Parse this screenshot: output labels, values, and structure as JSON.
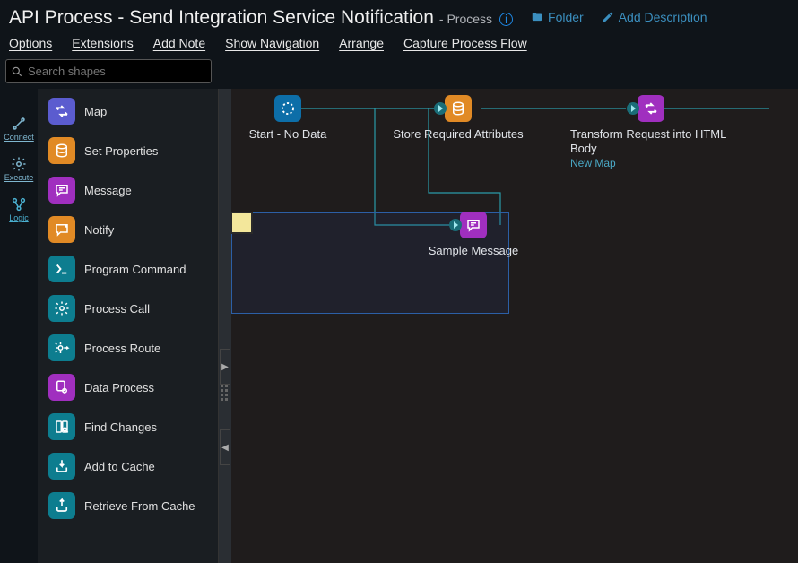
{
  "header": {
    "title": "API Process - Send Integration Service Notification",
    "subtype": "- Process",
    "folder_label": "Folder",
    "add_description_label": "Add Description"
  },
  "menubar": {
    "options": "Options",
    "extensions": "Extensions",
    "add_note": "Add Note",
    "show_navigation": "Show Navigation",
    "arrange": "Arrange",
    "capture_process_flow": "Capture Process Flow"
  },
  "search": {
    "placeholder": "Search shapes"
  },
  "left_tabs": {
    "connect": "Connect",
    "execute": "Execute",
    "logic": "Logic"
  },
  "palette": {
    "items": [
      {
        "label": "Map",
        "color": "c-indigo",
        "icon": "shuffle"
      },
      {
        "label": "Set Properties",
        "color": "c-orange",
        "icon": "barrel"
      },
      {
        "label": "Message",
        "color": "c-purple",
        "icon": "message"
      },
      {
        "label": "Notify",
        "color": "c-orange",
        "icon": "notify"
      },
      {
        "label": "Program Command",
        "color": "c-teal",
        "icon": "terminal"
      },
      {
        "label": "Process Call",
        "color": "c-teal",
        "icon": "gear"
      },
      {
        "label": "Process Route",
        "color": "c-teal",
        "icon": "gear-arrow"
      },
      {
        "label": "Data Process",
        "color": "c-purple",
        "icon": "doc-gear"
      },
      {
        "label": "Find Changes",
        "color": "c-teal",
        "icon": "diff"
      },
      {
        "label": "Add to Cache",
        "color": "c-teal",
        "icon": "cache-in"
      },
      {
        "label": "Retrieve From Cache",
        "color": "c-teal",
        "icon": "cache-out"
      }
    ]
  },
  "canvas": {
    "nodes": {
      "start": {
        "label": "Start - No Data"
      },
      "store": {
        "label": "Store Required Attributes"
      },
      "transform": {
        "label": "Transform Request into HTML Body",
        "sublabel": "New Map"
      },
      "sample": {
        "label": "Sample Message"
      }
    }
  }
}
